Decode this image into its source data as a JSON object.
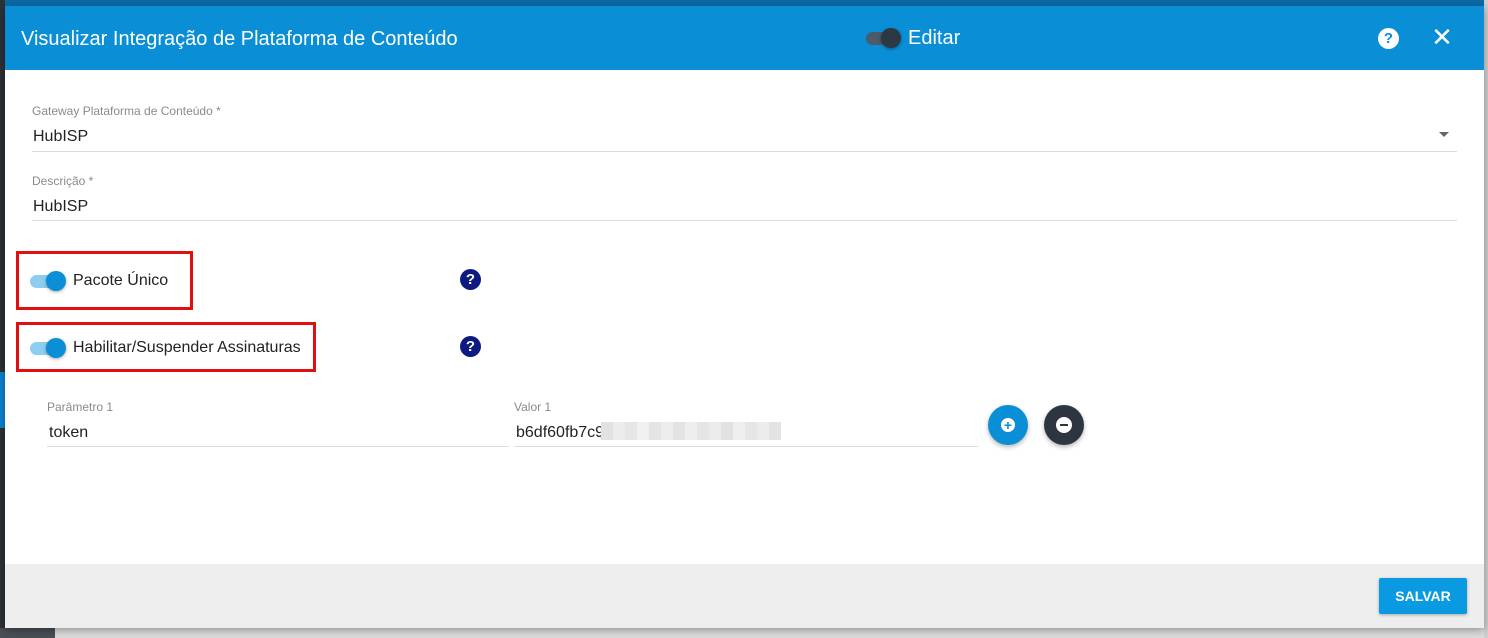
{
  "dialog": {
    "title": "Visualizar Integração de Plataforma de Conteúdo",
    "edit_label": "Editar",
    "help_symbol": "?",
    "close_symbol": "✕"
  },
  "form": {
    "gateway": {
      "label": "Gateway Plataforma de Conteúdo *",
      "value": "HubISP"
    },
    "description": {
      "label": "Descrição *",
      "value": "HubISP"
    },
    "pacote_unico": {
      "label": "Pacote Único",
      "enabled": true
    },
    "habilitar_suspender": {
      "label": "Habilitar/Suspender Assinaturas",
      "enabled": true
    },
    "info_symbol": "?",
    "parameters": [
      {
        "param_label": "Parâmetro 1",
        "param_value": "token",
        "value_label": "Valor 1",
        "value_visible": "b6df60fb7c9"
      }
    ],
    "add_symbol": "+"
  },
  "footer": {
    "save_label": "SALVAR"
  },
  "colors": {
    "header": "#0a8fd6",
    "accent": "#0a9ae2",
    "highlight": "#e01010",
    "info_icon": "#0d1a80"
  }
}
